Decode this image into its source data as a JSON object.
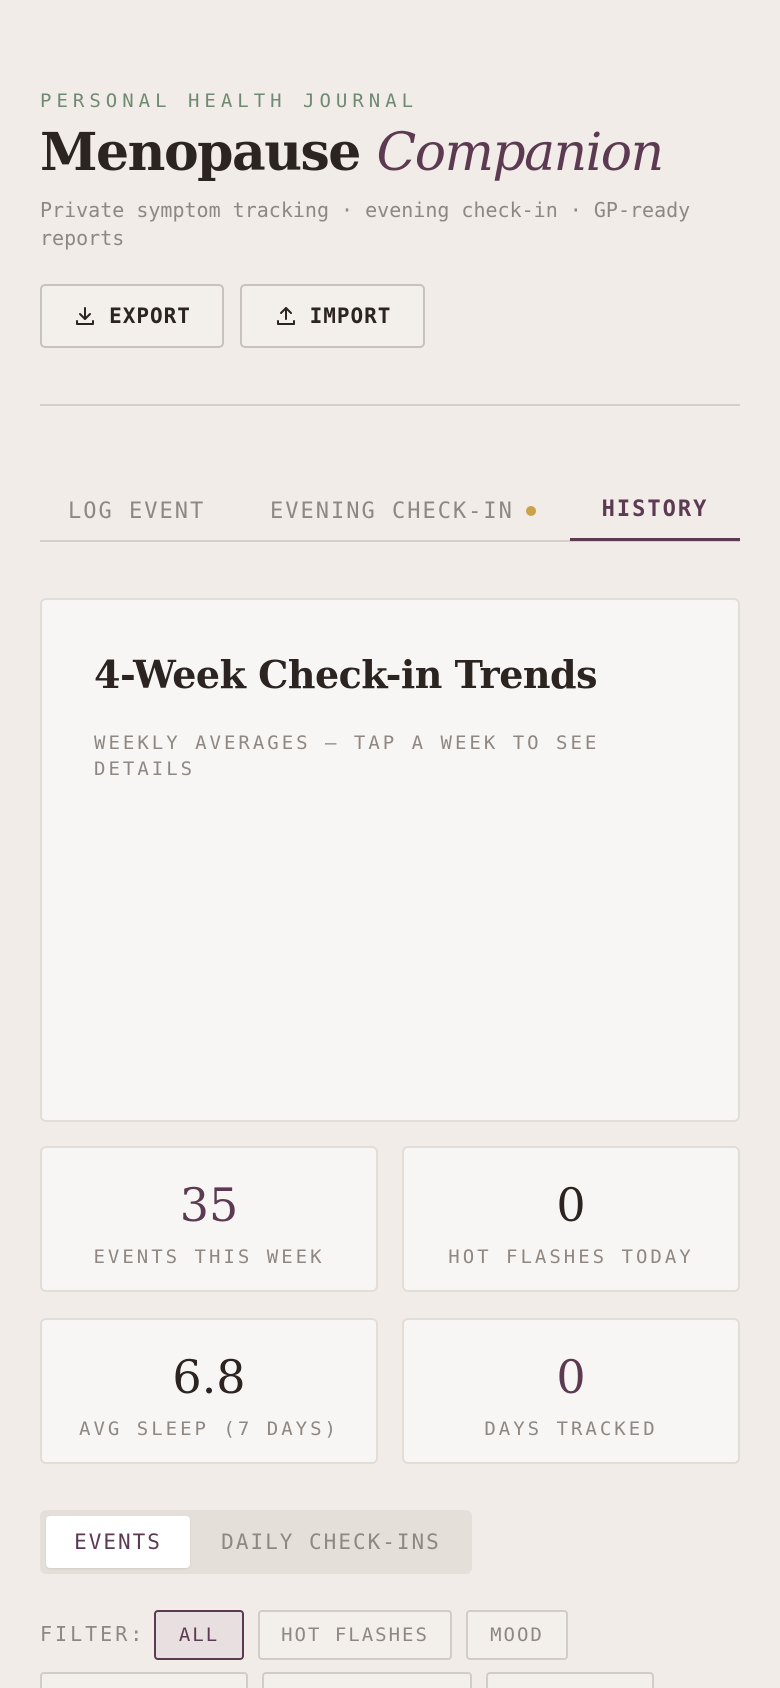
{
  "header": {
    "eyebrow": "PERSONAL HEALTH JOURNAL",
    "title_main": "Menopause",
    "title_accent": "Companion",
    "subtitle": "Private symptom tracking · evening check-in · GP-ready reports"
  },
  "actions": {
    "export_label": "EXPORT",
    "import_label": "IMPORT"
  },
  "tabs": [
    {
      "label": "LOG EVENT"
    },
    {
      "label": "EVENING CHECK-IN"
    },
    {
      "label": "HISTORY"
    }
  ],
  "trends": {
    "title": "4-Week Check-in Trends",
    "subtitle": "WEEKLY AVERAGES — TAP A WEEK TO SEE DETAILS"
  },
  "stats": [
    {
      "value": "35",
      "label": "EVENTS THIS WEEK"
    },
    {
      "value": "0",
      "label": "HOT FLASHES TODAY"
    },
    {
      "value": "6.8",
      "label": "AVG SLEEP (7 DAYS)"
    },
    {
      "value": "0",
      "label": "DAYS TRACKED"
    }
  ],
  "segment": {
    "events_label": "EVENTS",
    "daily_label": "DAILY CHECK-INS"
  },
  "filter": {
    "label": "FILTER:",
    "chips": [
      "ALL",
      "HOT FLASHES",
      "MOOD"
    ]
  },
  "colors": {
    "background": "#f1ece8",
    "accent_plum": "#5c3a52",
    "eyebrow_green": "#6f8a72",
    "notification_dot": "#c9a24a"
  }
}
